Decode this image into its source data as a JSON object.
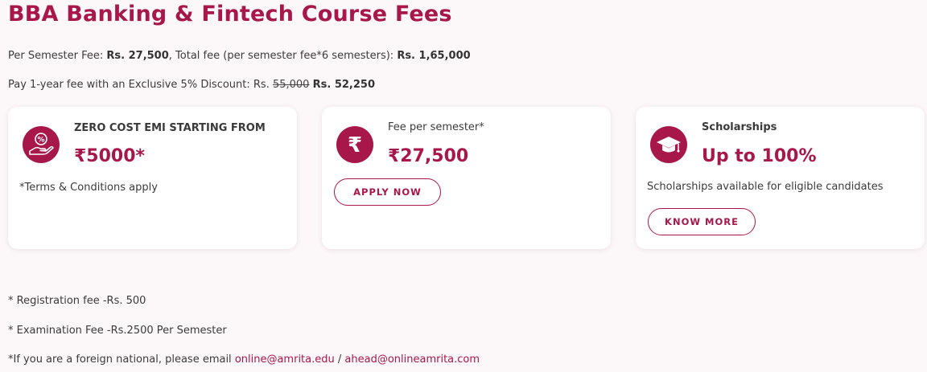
{
  "title": "BBA Banking & Fintech Course Fees",
  "fee_line": {
    "label1": "Per Semester Fee: ",
    "per_semester": "Rs. 27,500",
    "label2": ", Total fee (per semester fee*6 semesters): ",
    "total": "Rs. 1,65,000"
  },
  "discount_line": {
    "label": "Pay 1-year fee with an Exclusive 5% Discount: Rs. ",
    "original": "55,000",
    "discounted": "Rs. 52,250"
  },
  "cards": [
    {
      "icon": "percent-hand-icon",
      "label": "ZERO COST EMI STARTING FROM",
      "value": "₹5000*",
      "note": "*Terms & Conditions apply"
    },
    {
      "icon": "rupee-icon",
      "label": "Fee per semester*",
      "value": "₹27,500",
      "button": "APPLY NOW"
    },
    {
      "icon": "graduation-cap-icon",
      "label": "Scholarships",
      "value": "Up to 100%",
      "note": "Scholarships available for eligible candidates",
      "button": "KNOW MORE"
    }
  ],
  "footnotes": {
    "registration": " * Registration fee -Rs. 500",
    "examination": "* Examination Fee -Rs.2500 Per Semester",
    "foreign_prefix": "*If you are a foreign national, please email ",
    "email1": "online@amrita.edu",
    "separator": " / ",
    "email2": "ahead@onlineamrita.com"
  },
  "colors": {
    "accent": "#a8174a",
    "background": "#fcf7f9",
    "card": "#ffffff",
    "text": "#3b3b3b"
  }
}
